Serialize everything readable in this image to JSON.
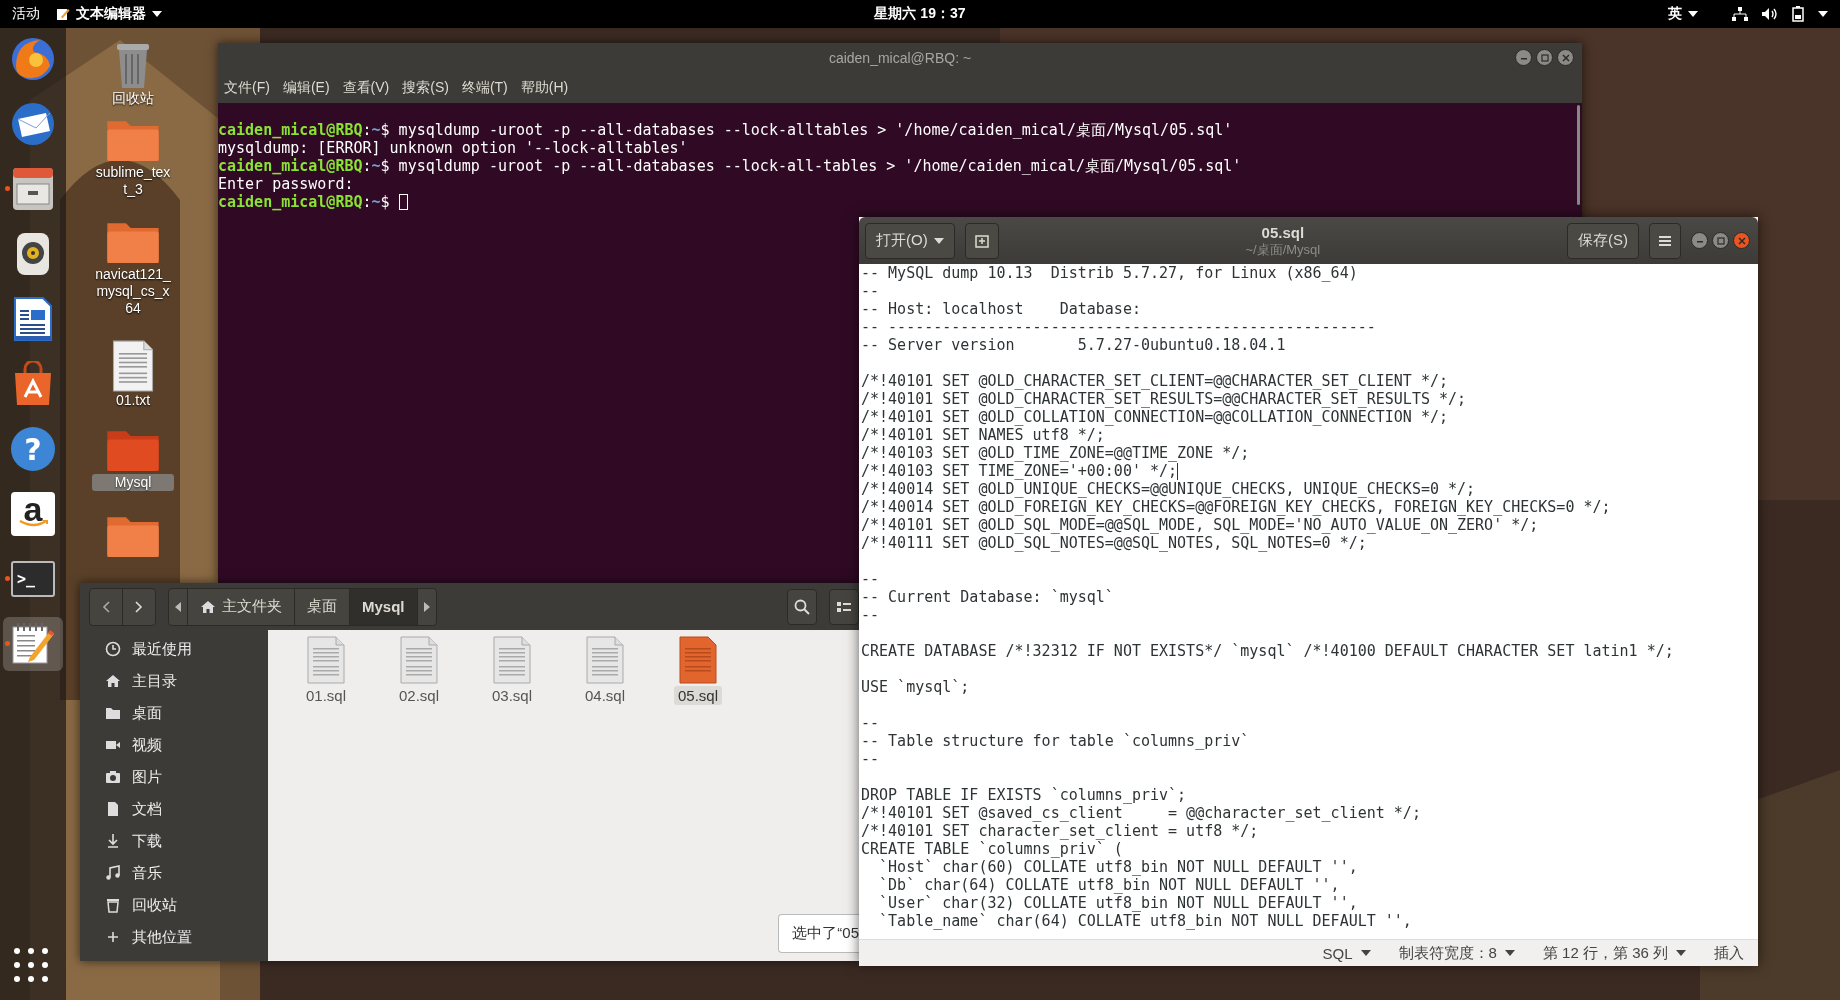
{
  "top_bar": {
    "activities": "活动",
    "app_menu": "文本编辑器",
    "clock": "星期六 19：37",
    "input_method": "英"
  },
  "dock": {
    "items": [
      {
        "kind": "browser",
        "running": false,
        "selected": false
      },
      {
        "kind": "mail",
        "running": false,
        "selected": false
      },
      {
        "kind": "files",
        "running": true,
        "selected": false
      },
      {
        "kind": "music",
        "running": false,
        "selected": false
      },
      {
        "kind": "writer",
        "running": false,
        "selected": false
      },
      {
        "kind": "store",
        "running": false,
        "selected": false
      },
      {
        "kind": "help",
        "glyph": "?",
        "running": false,
        "selected": false
      },
      {
        "kind": "amazon",
        "glyph": "a",
        "running": false,
        "selected": false
      },
      {
        "kind": "terminal",
        "glyph": ">_",
        "running": true,
        "selected": false
      },
      {
        "kind": "editor",
        "running": true,
        "selected": true
      }
    ]
  },
  "desktop": {
    "items": [
      {
        "kind": "trash",
        "label": "回收站",
        "selected": false
      },
      {
        "kind": "folder",
        "label": "sublime_text_3",
        "selected": false
      },
      {
        "kind": "folder",
        "label": "navicat121_mysql_cs_x64",
        "selected": false
      },
      {
        "kind": "text_file",
        "label": "01.txt",
        "selected": false
      },
      {
        "kind": "folder",
        "label": "Mysql",
        "selected": true
      },
      {
        "kind": "folder",
        "selected": false
      }
    ]
  },
  "terminal": {
    "title": "caiden_mical@RBQ: ~",
    "menu": [
      "文件(F)",
      "编辑(E)",
      "查看(V)",
      "搜索(S)",
      "终端(T)",
      "帮助(H)"
    ],
    "lines": [
      {
        "kind": "prompt",
        "user": "caiden_mical@RBQ",
        "separator": ":",
        "path": "~",
        "symbol": "$",
        "text": "mysqldump -uroot -p --all-databases --lock-alltables > '/home/caiden_mical/桌面/Mysql/05.sql'",
        "cursor": false
      },
      {
        "kind": "output",
        "text": "mysqldump: [ERROR] unknown option '--lock-alltables'",
        "cursor": false
      },
      {
        "kind": "prompt",
        "user": "caiden_mical@RBQ",
        "separator": ":",
        "path": "~",
        "symbol": "$",
        "text": "mysqldump -uroot -p --all-databases --lock-all-tables > '/home/caiden_mical/桌面/Mysql/05.sql'",
        "cursor": false
      },
      {
        "kind": "output",
        "text": "Enter password:",
        "cursor": false
      },
      {
        "kind": "prompt",
        "user": "caiden_mical@RBQ",
        "separator": ":",
        "path": "~",
        "symbol": "$",
        "cursor": true
      }
    ]
  },
  "files": {
    "path": [
      {
        "kind": "home",
        "label": "主文件夹",
        "selected": false
      },
      {
        "kind": "plain",
        "label": "桌面",
        "selected": false
      },
      {
        "kind": "plain",
        "label": "Mysql",
        "selected": true
      }
    ],
    "sidebar": [
      {
        "kind": "recent",
        "label": "最近使用"
      },
      {
        "kind": "home",
        "label": "主目录"
      },
      {
        "kind": "folder",
        "label": "桌面"
      },
      {
        "kind": "video",
        "label": "视频"
      },
      {
        "kind": "camera",
        "label": "图片"
      },
      {
        "kind": "document",
        "label": "文档"
      },
      {
        "kind": "download",
        "label": "下载"
      },
      {
        "kind": "music",
        "label": "音乐"
      },
      {
        "kind": "trash",
        "label": "回收站"
      },
      {
        "kind": "other",
        "label": "其他位置"
      }
    ],
    "items": [
      {
        "name": "01.sql",
        "selected": false
      },
      {
        "name": "02.sql",
        "selected": false
      },
      {
        "name": "03.sql",
        "selected": false
      },
      {
        "name": "04.sql",
        "selected": false
      },
      {
        "name": "05.sql",
        "selected": true
      }
    ],
    "status": "选中了“05"
  },
  "editor": {
    "open_button": "打开(O)",
    "title": "05.sql",
    "subtitle": "~/桌面/Mysql",
    "save_button": "保存(S)",
    "paragraphs": [
      [
        {
          "text": "-- MySQL dump 10.13  Distrib 5.7.27, for Linux (x86_64)",
          "cursor": false
        },
        {
          "text": "--",
          "cursor": false
        },
        {
          "text": "-- Host: localhost    Database:",
          "cursor": false
        },
        {
          "text": "-- ------------------------------------------------------",
          "cursor": false
        },
        {
          "text": "-- Server version       5.7.27-0ubuntu0.18.04.1",
          "cursor": false
        }
      ],
      [
        {
          "text": "/*!40101 SET @OLD_CHARACTER_SET_CLIENT=@@CHARACTER_SET_CLIENT */;",
          "cursor": false
        },
        {
          "text": "/*!40101 SET @OLD_CHARACTER_SET_RESULTS=@@CHARACTER_SET_RESULTS */;",
          "cursor": false
        },
        {
          "text": "/*!40101 SET @OLD_COLLATION_CONNECTION=@@COLLATION_CONNECTION */;",
          "cursor": false
        },
        {
          "text": "/*!40101 SET NAMES utf8 */;",
          "cursor": false
        },
        {
          "text": "/*!40103 SET @OLD_TIME_ZONE=@@TIME_ZONE */;",
          "cursor": false
        },
        {
          "text": "/*!40103 SET TIME_ZONE='+00:00' */;",
          "cursor": true
        },
        {
          "text": "/*!40014 SET @OLD_UNIQUE_CHECKS=@@UNIQUE_CHECKS, UNIQUE_CHECKS=0 */;",
          "cursor": false
        },
        {
          "text": "/*!40014 SET @OLD_FOREIGN_KEY_CHECKS=@@FOREIGN_KEY_CHECKS, FOREIGN_KEY_CHECKS=0 */;",
          "cursor": false
        },
        {
          "text": "/*!40101 SET @OLD_SQL_MODE=@@SQL_MODE, SQL_MODE='NO_AUTO_VALUE_ON_ZERO' */;",
          "cursor": false
        },
        {
          "text": "/*!40111 SET @OLD_SQL_NOTES=@@SQL_NOTES, SQL_NOTES=0 */;",
          "cursor": false
        }
      ],
      [
        {
          "text": "--",
          "cursor": false
        },
        {
          "text": "-- Current Database: `mysql`",
          "cursor": false
        },
        {
          "text": "--",
          "cursor": false
        }
      ],
      [
        {
          "text": "CREATE DATABASE /*!32312 IF NOT EXISTS*/ `mysql` /*!40100 DEFAULT CHARACTER SET latin1 */;",
          "cursor": false
        }
      ],
      [
        {
          "text": "USE `mysql`;",
          "cursor": false
        }
      ],
      [
        {
          "text": "--",
          "cursor": false
        },
        {
          "text": "-- Table structure for table `columns_priv`",
          "cursor": false
        },
        {
          "text": "--",
          "cursor": false
        }
      ],
      [
        {
          "text": "DROP TABLE IF EXISTS `columns_priv`;",
          "cursor": false
        },
        {
          "text": "/*!40101 SET @saved_cs_client     = @@character_set_client */;",
          "cursor": false
        },
        {
          "text": "/*!40101 SET character_set_client = utf8 */;",
          "cursor": false
        },
        {
          "text": "CREATE TABLE `columns_priv` (",
          "cursor": false
        },
        {
          "text": "  `Host` char(60) COLLATE utf8_bin NOT NULL DEFAULT '',",
          "cursor": false
        },
        {
          "text": "  `Db` char(64) COLLATE utf8_bin NOT NULL DEFAULT '',",
          "cursor": false
        },
        {
          "text": "  `User` char(32) COLLATE utf8_bin NOT NULL DEFAULT '',",
          "cursor": false
        },
        {
          "text": "  `Table_name` char(64) COLLATE utf8_bin NOT NULL DEFAULT '',",
          "cursor": false
        }
      ]
    ],
    "status_bar": {
      "language": "SQL",
      "tab_width": "制表符宽度：8",
      "position": "第 12 行，第 36 列",
      "mode": "插入"
    }
  }
}
